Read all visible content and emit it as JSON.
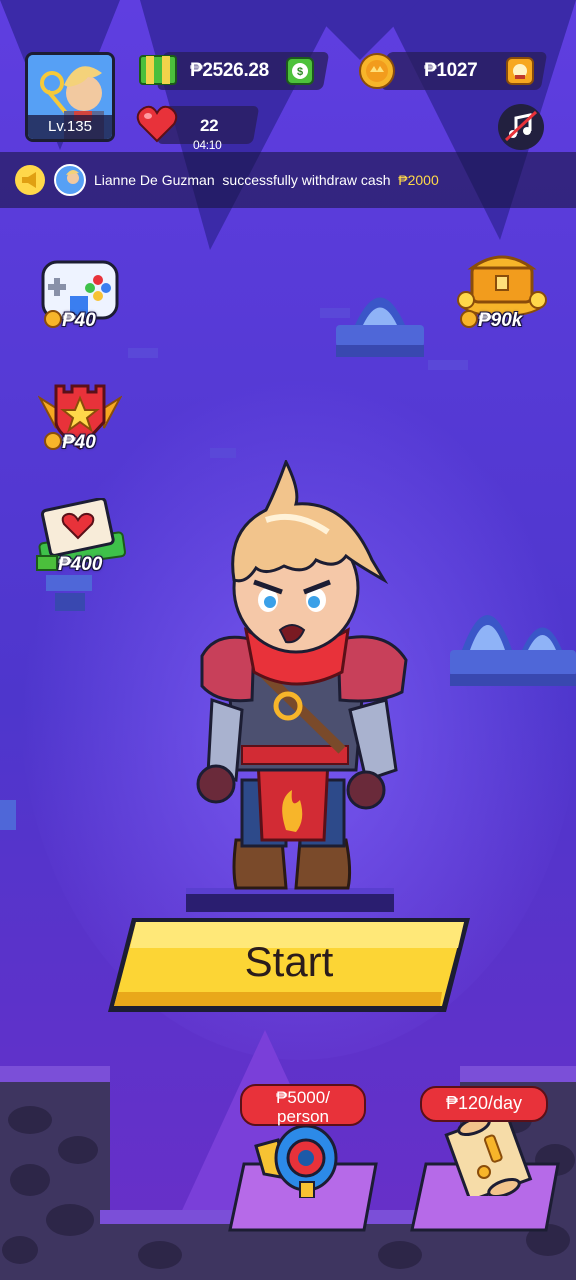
{
  "player": {
    "level_label": "Lv.135"
  },
  "currency": {
    "cash": "₱2526.28",
    "gold": "₱1027",
    "lives": "22",
    "lives_timer": "04:10"
  },
  "ticker": {
    "user": "Lianne De Guzman",
    "message": "successfully withdraw cash",
    "amount": "₱2000"
  },
  "side_buttons": {
    "games_cost": "₱40",
    "chest_cost": "₱90k",
    "badge_cost": "₱40",
    "card_cost": "₱400"
  },
  "start_label": "Start",
  "bottom": {
    "invite_tag": "₱5000/\nperson",
    "daily_tag": "₱120/day"
  },
  "colors": {
    "background": "#4b34c9",
    "start_button": "#fcd535",
    "tag_red": "#e8323a",
    "accent_yellow": "#ffd84a"
  },
  "icons": [
    "cash-icon",
    "gold-coin-icon",
    "heart-icon",
    "music-off-icon",
    "megaphone-icon",
    "gamepad-icon",
    "treasure-chest-icon",
    "shield-badge-icon",
    "love-letter-icon",
    "loudspeaker-icon",
    "scroll-icon"
  ]
}
